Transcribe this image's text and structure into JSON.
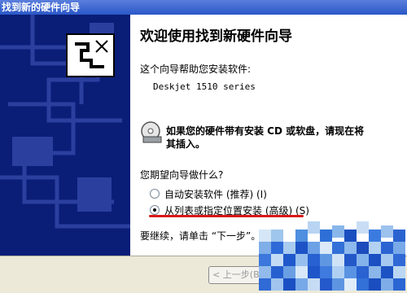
{
  "window": {
    "title": "找到新的硬件向导"
  },
  "wizard": {
    "heading": "欢迎使用找到新硬件向导",
    "intro": "这个向导帮助您安装软件:",
    "device_name": "Deskjet 1510 series",
    "cd_notice_line1": "如果您的硬件带有安装 CD 或软盘，请现在将",
    "cd_notice_line2": "其插入。",
    "question": "您期望向导做什么?",
    "options": [
      {
        "label": "自动安装软件 (推荐) (I)",
        "selected": false
      },
      {
        "label": "从列表或指定位置安装 (高级) (S)",
        "selected": true
      }
    ],
    "continue_text": "要继续，请单击 “下一步”。"
  },
  "buttons": {
    "back": "< 上一步(B)"
  },
  "colors": {
    "sidebar": "#0a1e78",
    "underline": "#d81818",
    "titlebar": "#2a58c8"
  },
  "icons": [
    "hardware-wizard-icon",
    "cd-icon"
  ]
}
